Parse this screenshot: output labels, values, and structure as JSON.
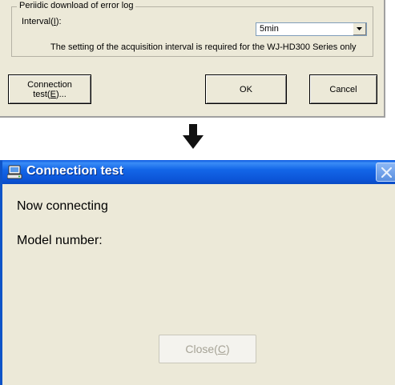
{
  "settings": {
    "group_legend": "Periidic download of error log",
    "interval_label_text": "Interval(",
    "interval_label_key": "I",
    "interval_label_end": "):",
    "interval_value": "5min",
    "note": "The setting of the acquisition interval is required for the WJ-HD300 Series only",
    "connection_test_line1": "Connection",
    "connection_test_line2_pre": "test(",
    "connection_test_key": "E",
    "connection_test_line2_post": ")...",
    "ok_label": "OK",
    "cancel_label": "Cancel"
  },
  "arrow_icon": "arrow-down-icon",
  "dialog": {
    "title": "Connection test",
    "status": "Now connecting",
    "model_label": "Model number:",
    "close_label_pre": "Close(",
    "close_key": "C",
    "close_label_post": ")"
  },
  "colors": {
    "titlebar": "#0c55d8",
    "dialog_bg": "#ece9d8",
    "disabled_text": "#a6a396"
  }
}
